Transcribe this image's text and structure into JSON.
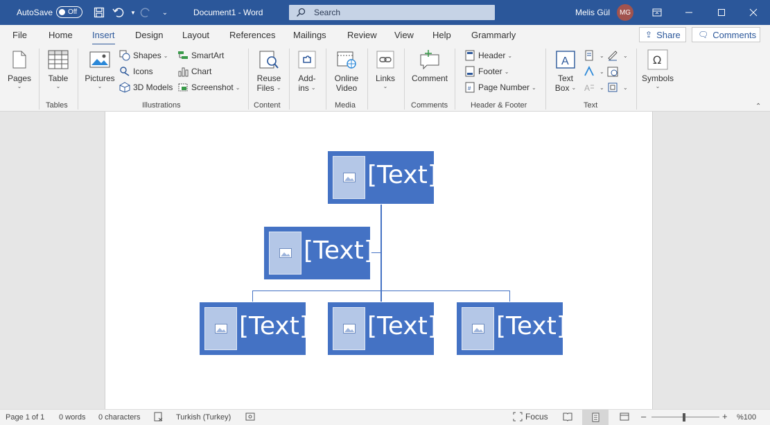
{
  "titlebar": {
    "autosave_label": "AutoSave",
    "autosave_state": "Off",
    "doc_title": "Document1  -  Word",
    "search_placeholder": "Search",
    "user_name": "Melis Gül",
    "avatar_initials": "MG"
  },
  "tabs": [
    {
      "label": "File"
    },
    {
      "label": "Home"
    },
    {
      "label": "Insert"
    },
    {
      "label": "Design"
    },
    {
      "label": "Layout"
    },
    {
      "label": "References"
    },
    {
      "label": "Mailings"
    },
    {
      "label": "Review"
    },
    {
      "label": "View"
    },
    {
      "label": "Help"
    },
    {
      "label": "Grammarly"
    }
  ],
  "share": {
    "share_label": "Share",
    "comments_label": "Comments"
  },
  "ribbon": {
    "pages": "Pages",
    "table": "Table",
    "tables_group": "Tables",
    "pictures": "Pictures",
    "shapes": "Shapes",
    "icons": "Icons",
    "models3d": "3D Models",
    "smartart": "SmartArt",
    "chart": "Chart",
    "screenshot": "Screenshot",
    "illustrations_group": "Illustrations",
    "reuse_files_1": "Reuse",
    "reuse_files_2": "Files",
    "content_group": "Content",
    "addins_1": "Add-",
    "addins_2": "ins",
    "online_video_1": "Online",
    "online_video_2": "Video",
    "media_group": "Media",
    "links": "Links",
    "comment": "Comment",
    "comments_group": "Comments",
    "header": "Header",
    "footer": "Footer",
    "page_number": "Page Number",
    "header_footer_group": "Header & Footer",
    "text_box_1": "Text",
    "text_box_2": "Box",
    "text_group": "Text",
    "symbols": "Symbols"
  },
  "smartart": {
    "placeholder": "[Text]"
  },
  "status": {
    "page": "Page 1 of 1",
    "words": "0 words",
    "characters": "0 characters",
    "language": "Turkish (Turkey)",
    "focus": "Focus",
    "zoom": "%100"
  },
  "colors": {
    "brand": "#2b579a",
    "smartart_fill": "#4472c4",
    "smartart_pic": "#b4c7e7"
  }
}
